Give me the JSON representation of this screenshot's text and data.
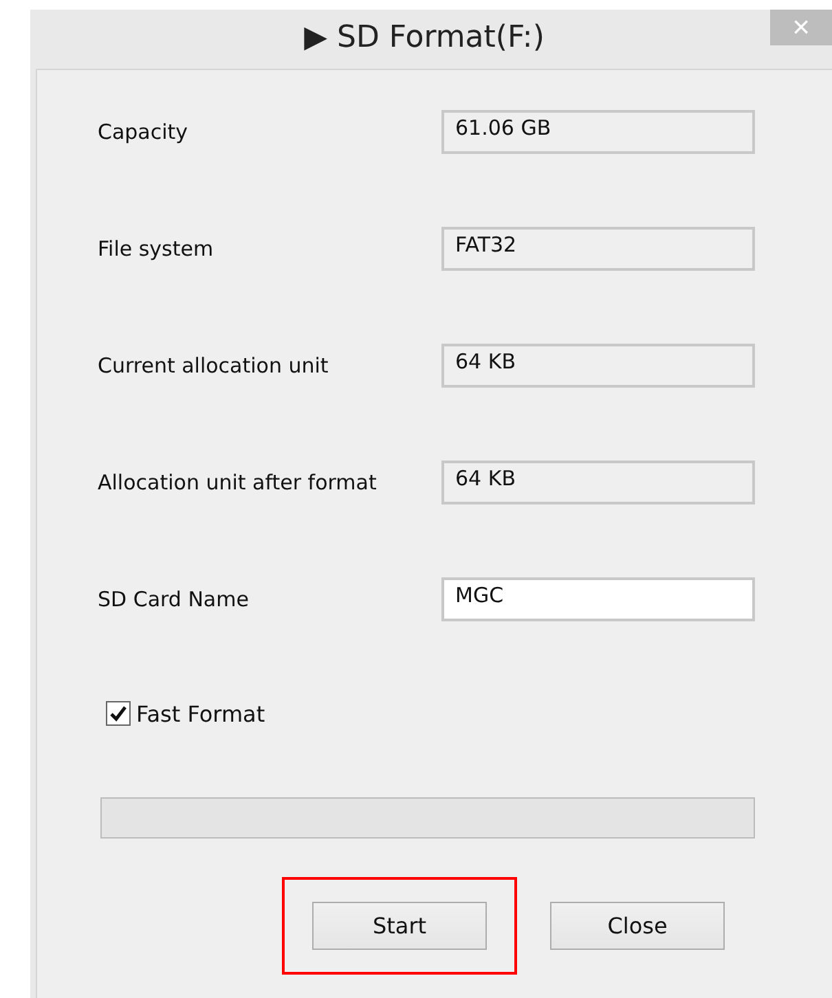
{
  "window": {
    "title_icon": "▶",
    "title": "SD Format(F:)",
    "close": "×"
  },
  "fields": [
    {
      "label": "Capacity",
      "value": "61.06 GB",
      "editable": false
    },
    {
      "label": "File system",
      "value": "FAT32",
      "editable": false
    },
    {
      "label": "Current allocation unit",
      "value": "64 KB",
      "editable": false
    },
    {
      "label": "Allocation unit after format",
      "value": "64 KB",
      "editable": false
    },
    {
      "label": "SD Card Name",
      "value": "MGC",
      "editable": true
    }
  ],
  "fast_format": {
    "label": "Fast Format",
    "checked": true
  },
  "progress": {
    "level": 0
  },
  "buttons": [
    {
      "label": "Start",
      "highlighted": true
    },
    {
      "label": "Close",
      "highlighted": false
    }
  ]
}
